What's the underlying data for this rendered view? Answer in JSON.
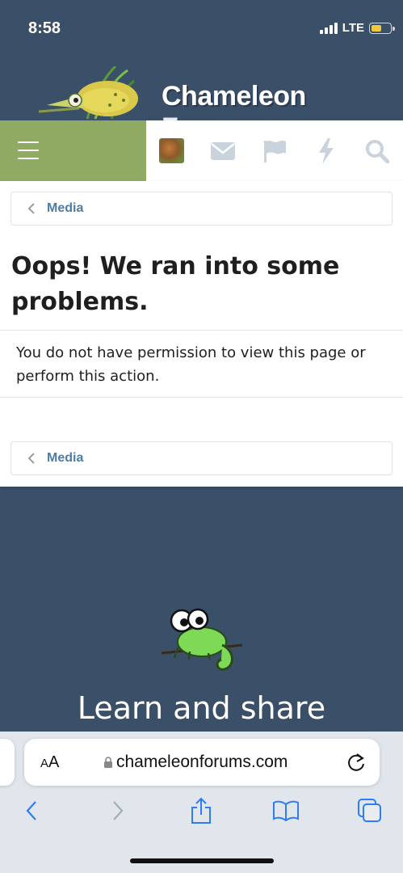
{
  "status_bar": {
    "time": "8:58",
    "network": "LTE"
  },
  "header": {
    "logo_text_main": "Chameleon",
    "logo_text_forums": "Forums"
  },
  "nav": {
    "icons": [
      "avatar",
      "envelope-icon",
      "flag-icon",
      "bolt-icon",
      "search-icon"
    ]
  },
  "breadcrumb": {
    "label": "Media"
  },
  "error": {
    "title": "Oops! We ran into some problems.",
    "message": "You do not have permission to view this page or perform this action."
  },
  "footer": {
    "title": "Learn and share"
  },
  "browser": {
    "aa_small": "A",
    "aa_large": "A",
    "url": "chameleonforums.com"
  },
  "colors": {
    "header_bg": "#3a5068",
    "menu_bg": "#8fab63",
    "link": "#4f7ca3",
    "nav_icon": "#c8d3dd"
  }
}
